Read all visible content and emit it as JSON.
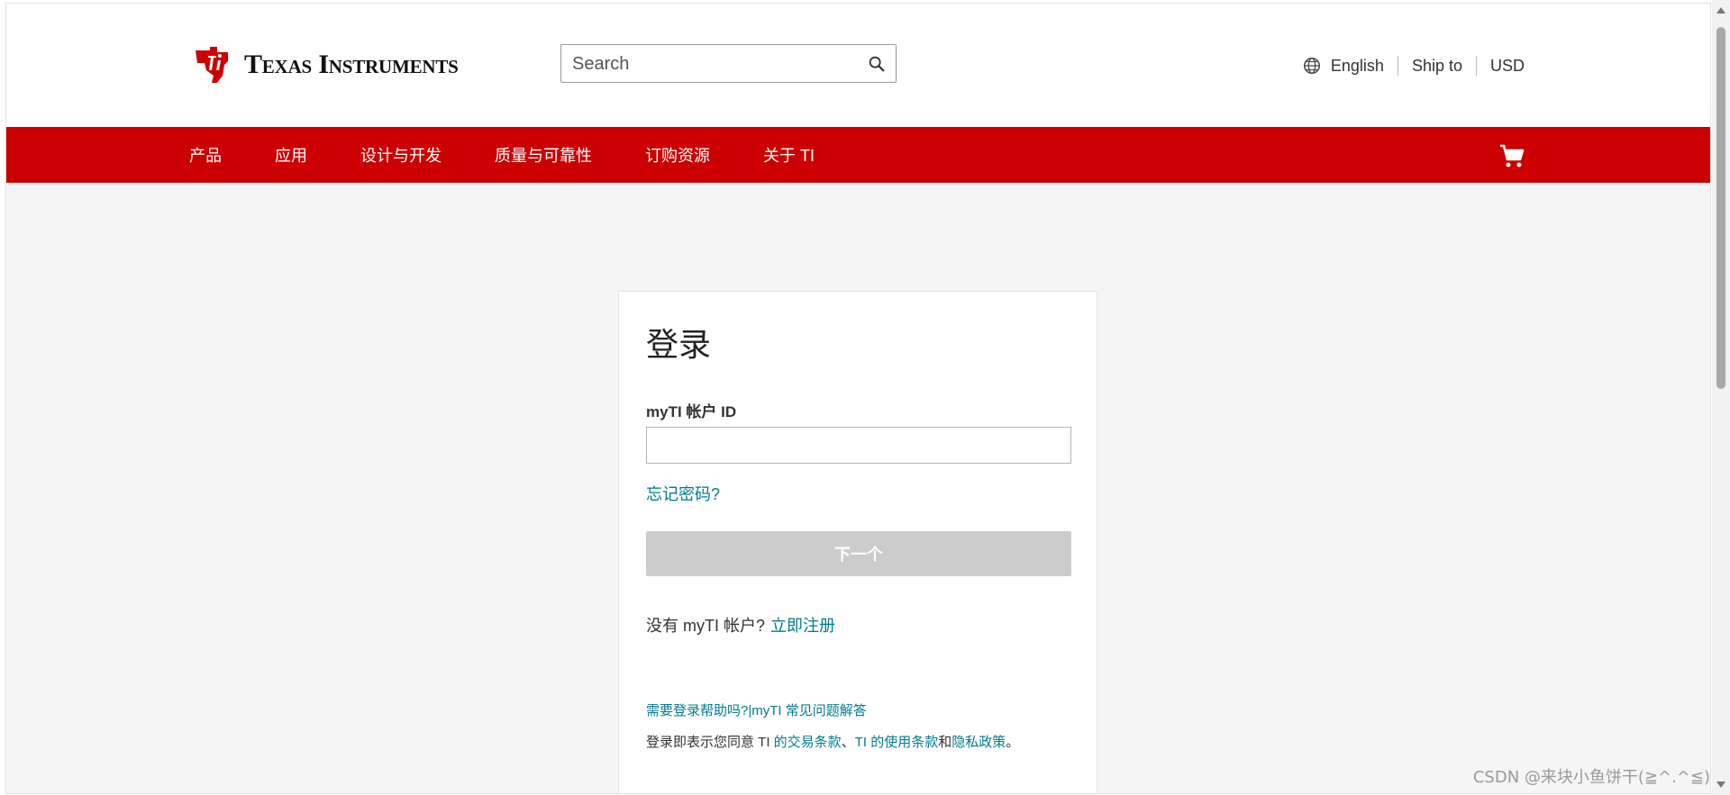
{
  "header": {
    "logo_text": "Texas Instruments",
    "search": {
      "placeholder": "Search",
      "value": ""
    },
    "language": "English",
    "ship_to": "Ship to",
    "currency": "USD"
  },
  "nav": {
    "items": [
      "产品",
      "应用",
      "设计与开发",
      "质量与可靠性",
      "订购资源",
      "关于 TI"
    ],
    "cart_icon": "shopping-cart-icon"
  },
  "login": {
    "title": "登录",
    "id_label": "myTI 帐户 ID",
    "id_value": "",
    "forgot_password": "忘记密码?",
    "next_button": "下一个",
    "no_account": "没有 myTI 帐户?",
    "register_link": "立即注册",
    "help_link": "需要登录帮助吗?",
    "faq_separator": "|",
    "faq_link": "myTI 常见问题解答",
    "terms_prefix": "登录即表示您同意 TI ",
    "terms_link1": "的交易条款",
    "terms_sep": "、",
    "terms_link2": "TI 的使用条款",
    "terms_and": "和",
    "terms_link3": "隐私政策",
    "terms_end": "。"
  },
  "watermark": "CSDN @来块小鱼饼干(≧^.^≦)",
  "colors": {
    "nav_red": "#cc0000",
    "link_teal": "#007c8c",
    "disabled_button": "#cccccc"
  }
}
